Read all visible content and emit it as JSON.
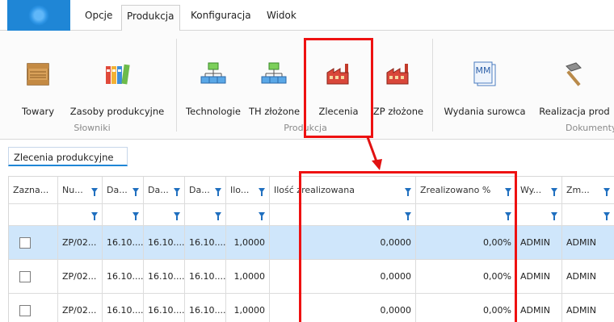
{
  "menu": {
    "tabs": [
      {
        "label": "Opcje"
      },
      {
        "label": "Produkcja"
      },
      {
        "label": "Konfiguracja"
      },
      {
        "label": "Widok"
      }
    ]
  },
  "ribbon": {
    "buttons": [
      {
        "label": "Towary",
        "icon": "crate-icon"
      },
      {
        "label": "Zasoby produkcyjne",
        "icon": "binders-icon"
      },
      {
        "label": "Technologie",
        "icon": "hierarchy-icon"
      },
      {
        "label": "TH złożone",
        "icon": "hierarchy-icon"
      },
      {
        "label": "Zlecenia",
        "icon": "factory-icon"
      },
      {
        "label": "ZP złożone",
        "icon": "factory-icon"
      },
      {
        "label": "Wydania surowca",
        "icon": "mm-document-icon"
      },
      {
        "label": "Realizacja prod",
        "icon": "hammer-icon"
      }
    ],
    "groups": [
      {
        "label": "Słowniki"
      },
      {
        "label": "Produkcja"
      },
      {
        "label": "Dokumenty"
      }
    ]
  },
  "document_tab": {
    "label": "Zlecenia produkcyjne"
  },
  "grid": {
    "headers": [
      "Zazna...",
      "Nu...",
      "Da...",
      "Da...",
      "Da...",
      "Ilo...",
      "Ilość zrealizowana",
      "Zrealizowano %",
      "Wy...",
      "Zm..."
    ],
    "rows": [
      [
        "",
        "ZP/02...",
        "16.10....",
        "16.10....",
        "16.10....",
        "1,0000",
        "0,0000",
        "0,00%",
        "ADMIN",
        "ADMIN"
      ],
      [
        "",
        "ZP/02...",
        "16.10....",
        "16.10....",
        "16.10....",
        "1,0000",
        "0,0000",
        "0,00%",
        "ADMIN",
        "ADMIN"
      ],
      [
        "",
        "ZP/02...",
        "16.10....",
        "16.10....",
        "16.10....",
        "1,0000",
        "0,0000",
        "0,00%",
        "ADMIN",
        "ADMIN"
      ]
    ]
  },
  "colors": {
    "accent": "#1f86d6",
    "highlight": "#e11111",
    "selected_row": "#cfe6fb"
  }
}
